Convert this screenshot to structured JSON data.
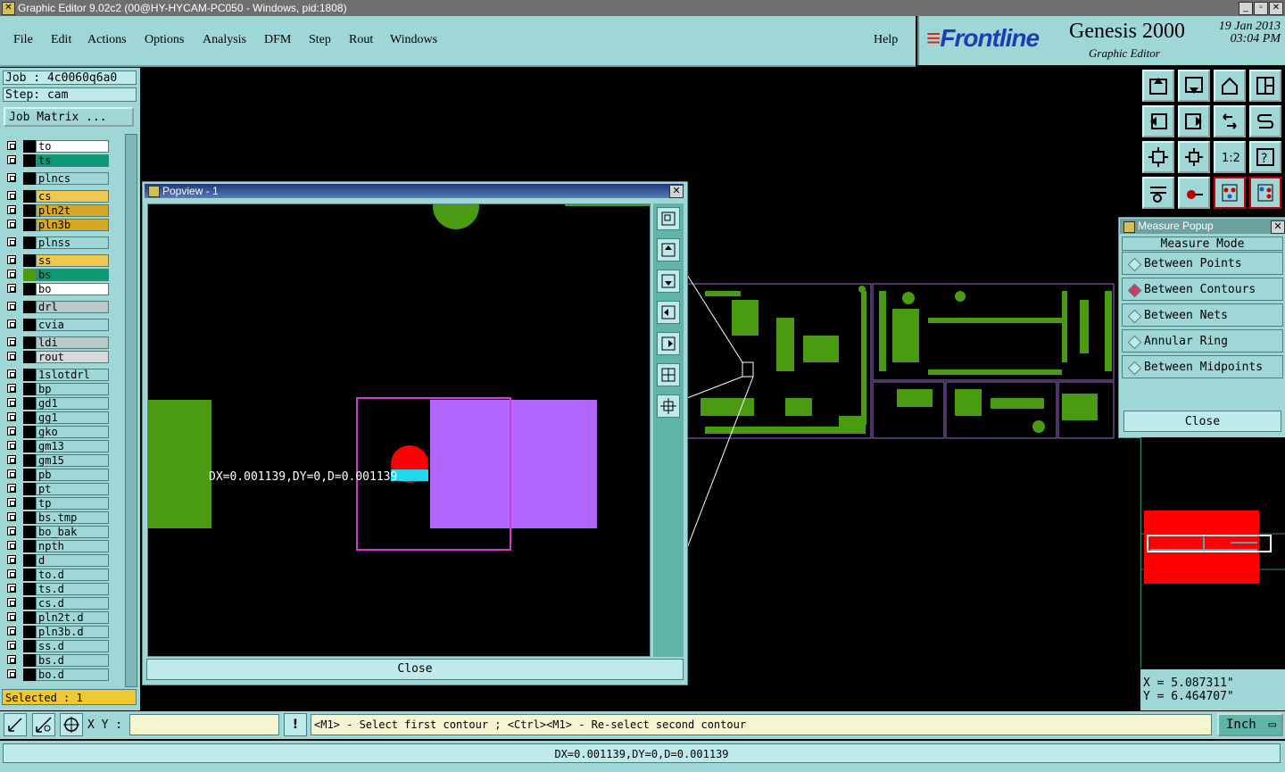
{
  "window": {
    "title": "Graphic Editor 9.02c2 (00@HY-HYCAM-PC050 - Windows, pid:1808)"
  },
  "menu": [
    "File",
    "Edit",
    "Actions",
    "Options",
    "Analysis",
    "DFM",
    "Step",
    "Rout",
    "Windows"
  ],
  "menu_help": "Help",
  "brand": {
    "logo": "Frontline",
    "product": "Genesis 2000",
    "subtitle": "Graphic Editor",
    "date": "19 Jan 2013",
    "time": "03:04 PM"
  },
  "job": {
    "job_text": "Job : 4c0060q6a0",
    "step_text": "Step: cam",
    "matrix_button": "Job Matrix ..."
  },
  "layers": [
    {
      "name": "to",
      "color": "#ffffff"
    },
    {
      "name": "ts",
      "color": "#0a9a74"
    },
    {
      "name": "plncs",
      "color": "#9fd6d6"
    },
    {
      "name": "cs",
      "color": "#f0c850"
    },
    {
      "name": "pln2t",
      "color": "#d6a828"
    },
    {
      "name": "pln3b",
      "color": "#d6a828"
    },
    {
      "name": "plnss",
      "color": "#9fd6d6"
    },
    {
      "name": "ss",
      "color": "#f0c850"
    },
    {
      "name": "bs",
      "color": "#0a9a74"
    },
    {
      "name": "bo",
      "color": "#ffffff"
    },
    {
      "name": "drl",
      "color": "#b8c8c8"
    },
    {
      "name": "cvia",
      "color": "#9fd6d6"
    },
    {
      "name": "ldi",
      "color": "#b8c8c8"
    },
    {
      "name": "rout",
      "color": "#d8d8d8"
    },
    {
      "name": "1slotdrl",
      "color": "#9fd6d6"
    },
    {
      "name": "bp",
      "color": "#9fd6d6"
    },
    {
      "name": "gd1",
      "color": "#9fd6d6"
    },
    {
      "name": "gg1",
      "color": "#9fd6d6"
    },
    {
      "name": "gko",
      "color": "#9fd6d6"
    },
    {
      "name": "gm13",
      "color": "#9fd6d6"
    },
    {
      "name": "gm15",
      "color": "#9fd6d6"
    },
    {
      "name": "pb",
      "color": "#9fd6d6"
    },
    {
      "name": "pt",
      "color": "#9fd6d6"
    },
    {
      "name": "tp",
      "color": "#9fd6d6"
    },
    {
      "name": "bs.tmp",
      "color": "#9fd6d6"
    },
    {
      "name": "bo_bak",
      "color": "#9fd6d6"
    },
    {
      "name": "npth",
      "color": "#9fd6d6"
    },
    {
      "name": "d",
      "color": "#9fd6d6"
    },
    {
      "name": "to.d",
      "color": "#9fd6d6"
    },
    {
      "name": "ts.d",
      "color": "#9fd6d6"
    },
    {
      "name": "cs.d",
      "color": "#9fd6d6"
    },
    {
      "name": "pln2t.d",
      "color": "#9fd6d6"
    },
    {
      "name": "pln3b.d",
      "color": "#9fd6d6"
    },
    {
      "name": "ss.d",
      "color": "#9fd6d6"
    },
    {
      "name": "bs.d",
      "color": "#9fd6d6"
    },
    {
      "name": "bo.d",
      "color": "#9fd6d6"
    }
  ],
  "selected_text": "Selected : 1",
  "popview": {
    "title": "Popview - 1",
    "measure_label": "DX=0.001139,DY=0,D=0.001139",
    "close": "Close"
  },
  "measure_popup": {
    "title": "Measure Popup",
    "header": "Measure Mode",
    "options": [
      "Between Points",
      "Between Contours",
      "Between Nets",
      "Annular Ring",
      "Between Midpoints"
    ],
    "selected_index": 1,
    "close": "Close"
  },
  "coords": {
    "x_text": "X  =  5.087311\"",
    "y_text": "Y  =  6.464707\""
  },
  "command": {
    "xy_label": "X Y :",
    "xy_value": "",
    "prompt": "<M1> - Select first contour ; <Ctrl><M1> - Re-select second contour",
    "units": "Inch"
  },
  "status": {
    "text": "DX=0.001139,DY=0,D=0.001139"
  },
  "colors": {
    "panel": "#9fd6d6",
    "accent_green": "#4a9a12",
    "purple": "#b266ff",
    "red": "#ff0000",
    "cyan": "#22d8e8"
  }
}
